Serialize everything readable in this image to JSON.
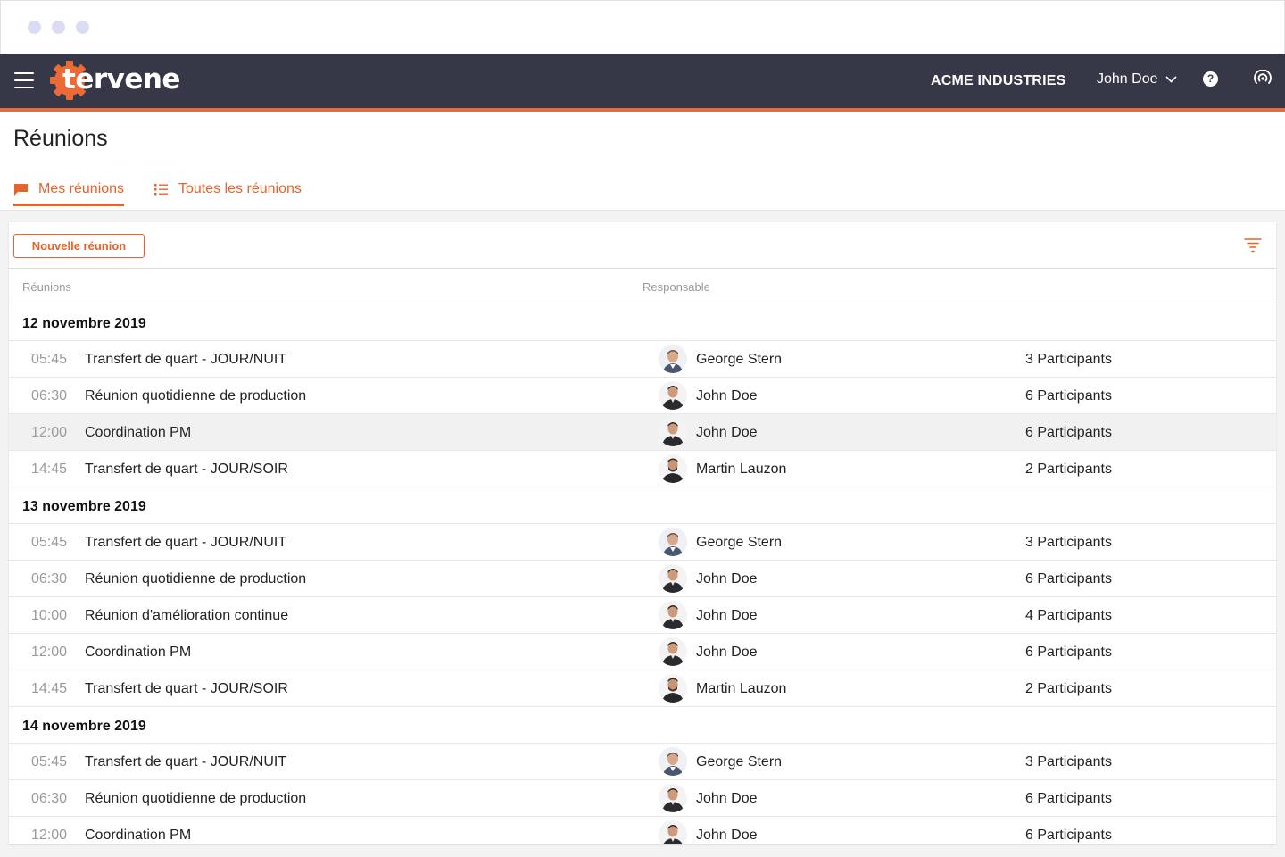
{
  "header": {
    "logo_text": "tervene",
    "company": "ACME INDUSTRIES",
    "user_name": "John Doe",
    "help_glyph": "?",
    "accent_color": "#ec6a35",
    "bar_color": "#363847"
  },
  "page": {
    "title": "Réunions",
    "tabs": [
      {
        "label": "Mes réunions",
        "icon": "chat-bubble-icon"
      },
      {
        "label": "Toutes les réunions",
        "icon": "list-icon"
      }
    ]
  },
  "toolbar": {
    "new_label": "Nouvelle réunion"
  },
  "columns": {
    "meetings": "Réunions",
    "owner": "Responsable"
  },
  "groups": [
    {
      "date": "12 novembre 2019",
      "rows": [
        {
          "time": "05:45",
          "name": "Transfert de quart - JOUR/NUIT",
          "owner": "George Stern",
          "participants": "3 Participants"
        },
        {
          "time": "06:30",
          "name": "Réunion quotidienne de production",
          "owner": "John Doe",
          "participants": "6 Participants"
        },
        {
          "time": "12:00",
          "name": "Coordination PM",
          "owner": "John Doe",
          "participants": "6 Participants"
        },
        {
          "time": "14:45",
          "name": "Transfert de quart - JOUR/SOIR",
          "owner": "Martin Lauzon",
          "participants": "2 Participants"
        }
      ]
    },
    {
      "date": "13 novembre 2019",
      "rows": [
        {
          "time": "05:45",
          "name": "Transfert de quart - JOUR/NUIT",
          "owner": "George Stern",
          "participants": "3 Participants"
        },
        {
          "time": "06:30",
          "name": "Réunion quotidienne de production",
          "owner": "John Doe",
          "participants": "6 Participants"
        },
        {
          "time": "10:00",
          "name": "Réunion d'amélioration continue",
          "owner": "John Doe",
          "participants": "4 Participants"
        },
        {
          "time": "12:00",
          "name": "Coordination PM",
          "owner": "John Doe",
          "participants": "6 Participants"
        },
        {
          "time": "14:45",
          "name": "Transfert de quart - JOUR/SOIR",
          "owner": "Martin Lauzon",
          "participants": "2 Participants"
        }
      ]
    },
    {
      "date": "14 novembre 2019",
      "rows": [
        {
          "time": "05:45",
          "name": "Transfert de quart - JOUR/NUIT",
          "owner": "George Stern",
          "participants": "3 Participants"
        },
        {
          "time": "06:30",
          "name": "Réunion quotidienne de production",
          "owner": "John Doe",
          "participants": "6 Participants"
        },
        {
          "time": "12:00",
          "name": "Coordination PM",
          "owner": "John Doe",
          "participants": "6 Participants"
        }
      ]
    }
  ]
}
